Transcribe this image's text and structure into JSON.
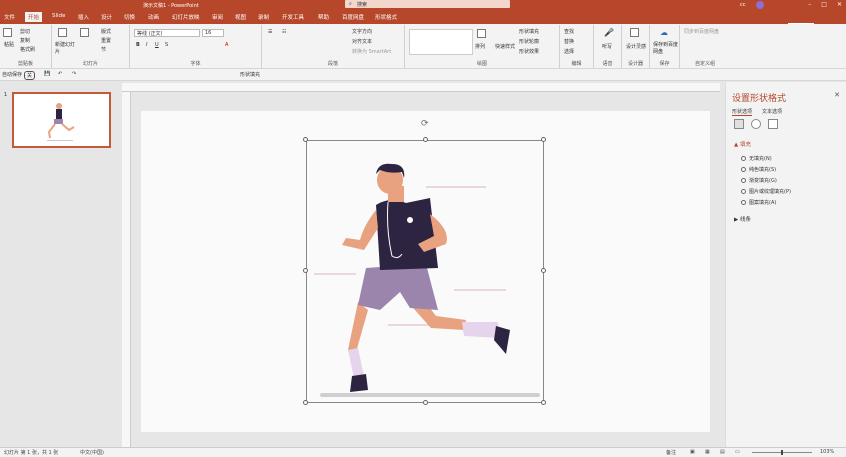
{
  "window": {
    "title": "演示文稿1 - PowerPoint",
    "search_placeholder": "搜索",
    "account": "cc",
    "share": "共享"
  },
  "tabs": [
    "文件",
    "开始",
    "Slide",
    "插入",
    "设计",
    "切换",
    "动画",
    "幻灯片放映",
    "审阅",
    "视图",
    "录制",
    "开发工具",
    "帮助",
    "百度网盘",
    "形状格式"
  ],
  "active_tab": "开始",
  "ribbon": {
    "groups": [
      "剪贴板",
      "幻灯片",
      "字体",
      "段落",
      "绘图",
      "编辑",
      "语音",
      "设计器",
      "保存",
      "自定义组"
    ],
    "buttons": {
      "paste": "粘贴",
      "cut": "剪切",
      "copy": "复制",
      "format_painter": "格式刷",
      "new_slide": "新建幻灯片",
      "reuse": "重用幻灯片",
      "layout": "版式",
      "reset": "重置",
      "section": "节",
      "font_name": "等线 (正文)",
      "font_size": "16",
      "text_direction": "文字方向",
      "align_text": "对齐文本",
      "smartart": "转换为 SmartArt",
      "arrange": "排列",
      "quick_styles": "快速样式",
      "shape_fill": "形状填充",
      "shape_outline": "形状轮廓",
      "shape_effects": "形状效果",
      "find": "查找",
      "replace": "替换",
      "select": "选择",
      "dictate": "听写",
      "designer": "设计灵感",
      "save_baidu": "保存到百度网盘",
      "sync": "同步到百度网盘"
    }
  },
  "qat": {
    "autosave": "自动保存",
    "autosave_state": "关",
    "shape_fill": "形状填充"
  },
  "slides": [
    {
      "number": "1"
    }
  ],
  "panel": {
    "title": "设置形状格式",
    "tabs": [
      "形状选项",
      "文本选项"
    ],
    "section_fill": "填充",
    "fill_options": [
      "无填充(N)",
      "纯色填充(S)",
      "渐变填充(G)",
      "图片或纹理填充(P)",
      "图案填充(A)"
    ],
    "section_line": "线条"
  },
  "status": {
    "slide_info": "幻灯片 第 1 张，共 1 张",
    "language": "中文(中国)",
    "notes": "备注",
    "zoom": "103%"
  }
}
